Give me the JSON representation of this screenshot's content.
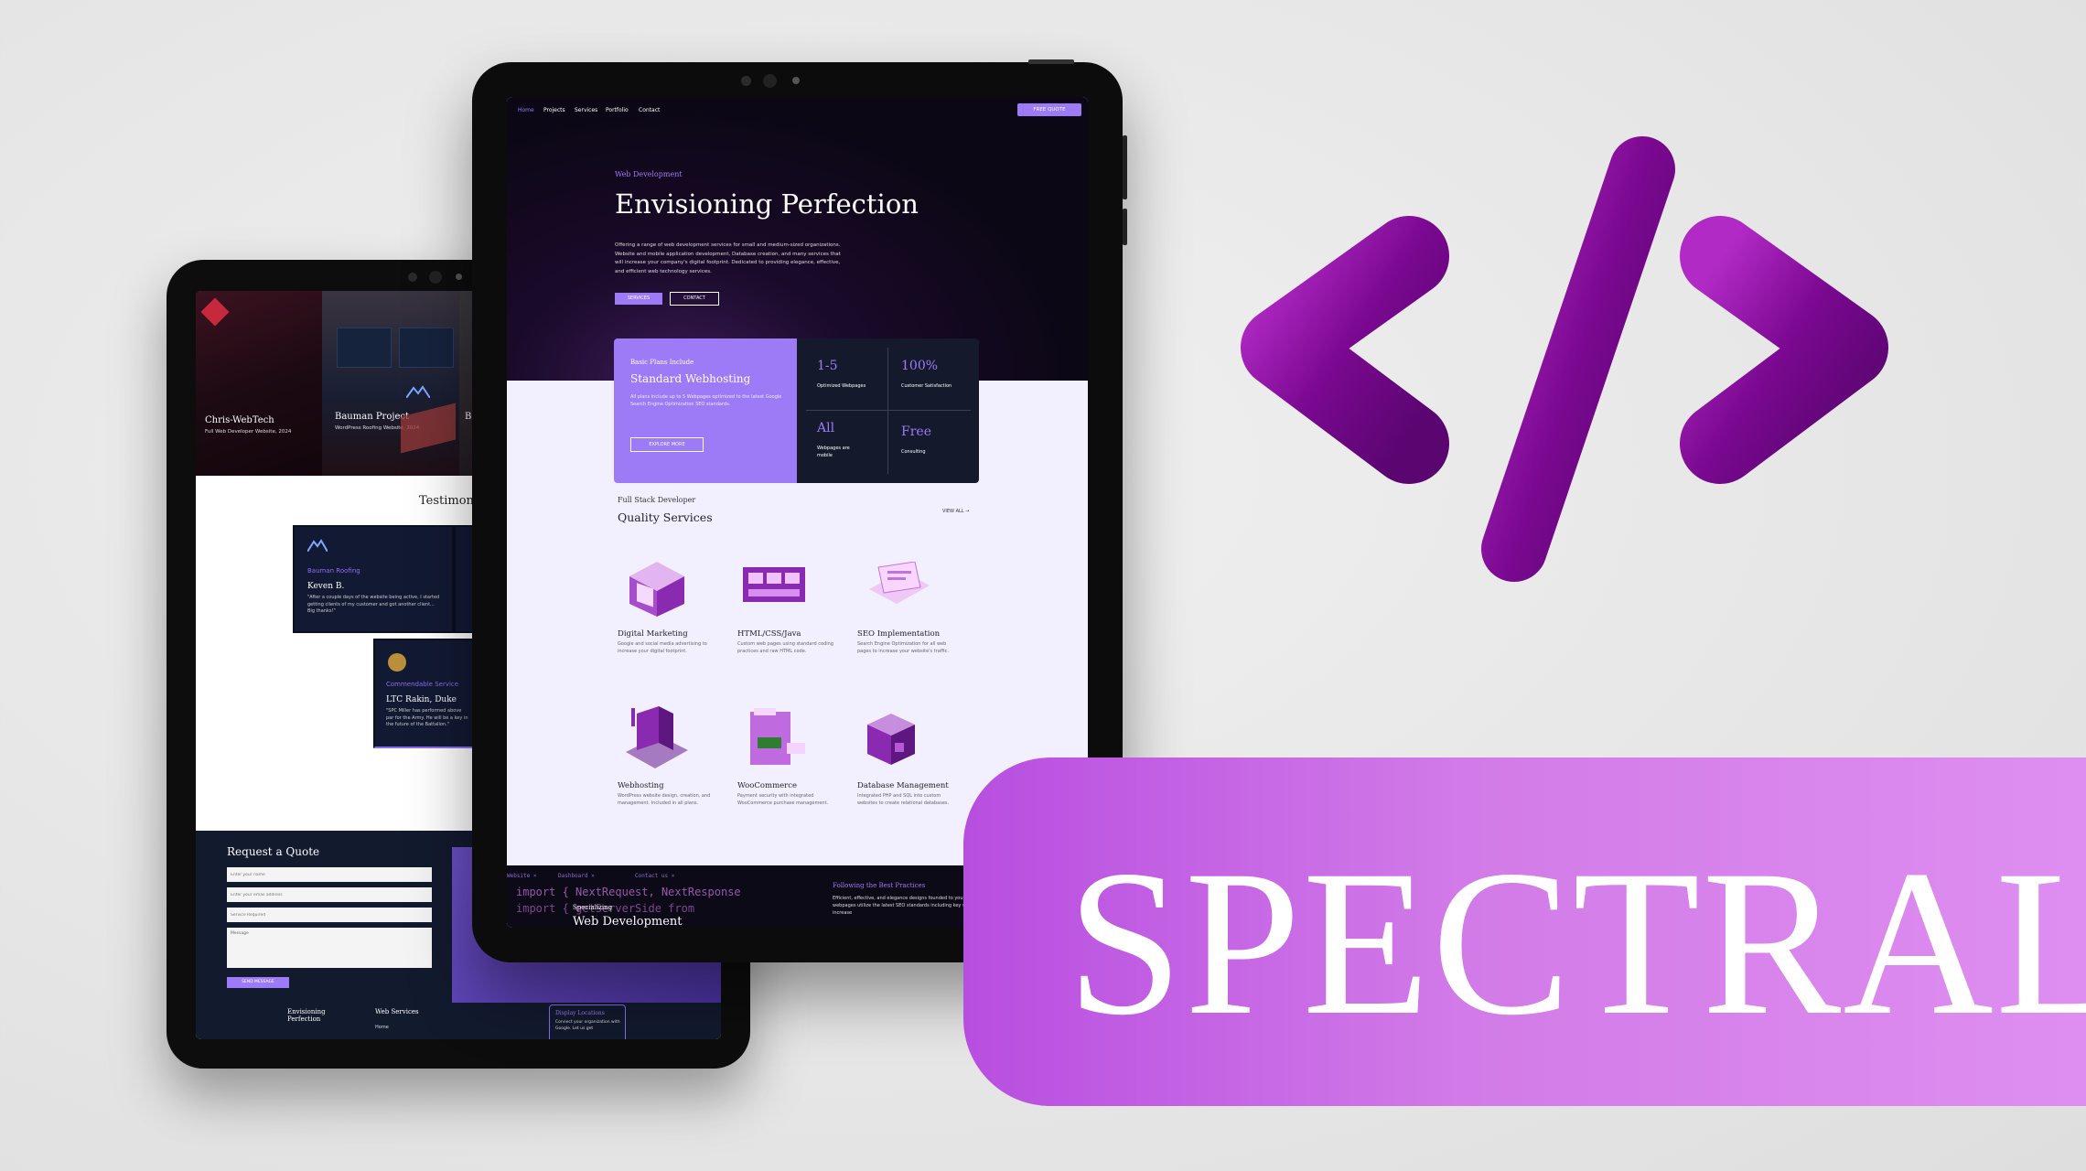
{
  "brand": {
    "name": "SPECTRAL"
  },
  "colors": {
    "accent": "#9d7bf7",
    "banner": "#d27be8",
    "code_icon": "#8a0b9e",
    "dark": "#0b0714"
  },
  "icon": {
    "name": "code-brackets-icon"
  },
  "front": {
    "nav": [
      "Home",
      "Projects",
      "Services",
      "Portfolio",
      "Contact"
    ],
    "nav_button": "FREE QUOTE",
    "hero": {
      "eyebrow": "Web Development",
      "title": "Envisioning Perfection",
      "desc": "Offering a range of web development services for small and medium-sized organizations. Website and mobile application development, Database creation, and many services that will increase your company's digital footprint. Dedicated to providing elegance, effective, and efficient web technology services.",
      "btn_services": "SERVICES",
      "btn_contact": "CONTACT"
    },
    "plan": {
      "eyebrow": "Basic Plans Include",
      "title": "Standard Webhosting",
      "desc": "All plans include up to 5 Webpages optimized to the latest Google Search Engine Optimization SEO standards.",
      "button": "EXPLORE MORE"
    },
    "stats": [
      {
        "num": "1-5",
        "label": "Optimized Webpages"
      },
      {
        "num": "100%",
        "label": "Customer Satisfaction"
      },
      {
        "num": "All",
        "label": "Webpages are mobile"
      },
      {
        "num": "Free",
        "label": "Consulting"
      }
    ],
    "services": {
      "eyebrow": "Full Stack Developer",
      "title": "Quality Services",
      "view_all": "VIEW ALL →",
      "items": [
        {
          "title": "Digital Marketing",
          "desc": "Google and social media advertising to increase your digital footprint."
        },
        {
          "title": "HTML/CSS/Java",
          "desc": "Custom web pages using standard coding practices and raw HTML code."
        },
        {
          "title": "SEO Implementation",
          "desc": "Search Engine Optimization for all web pages to increase your website's traffic."
        },
        {
          "title": "Webhosting",
          "desc": "WordPress website design, creation, and management. Included in all plans."
        },
        {
          "title": "WooCommerce",
          "desc": "Payment security with integrated WooCommerce purchase management."
        },
        {
          "title": "Database Management",
          "desc": "Integrated PHP and SQL into custom websites to create relational databases."
        }
      ]
    },
    "bottom": {
      "code_tabs": [
        "Website ×",
        "Dashboard ×",
        "Contact us ×"
      ],
      "code_lines": [
        "import { NextRequest, NextResponse",
        "import { getServerSide from"
      ],
      "code_sub": "Specializing",
      "code_title": "Web Development",
      "right_title": "Following the Best Practices",
      "right_desc": "Efficient, effective, and elegance designs founded to your organizations requirements. All webpages utilize the latest SEO standards including key word search optimization to increase"
    }
  },
  "back": {
    "projects": [
      {
        "title": "Chris-WebTech",
        "sub": "Full Web Developer Website, 2024"
      },
      {
        "title": "Bauman Project",
        "sub": "WordPress Roofing Website, 2024"
      }
    ],
    "projects_partial": "B",
    "testimonials_title": "Testimon",
    "testimonials": [
      {
        "company": "Bauman Roofing",
        "name": "Keven B.",
        "text": "\"After a couple days of the website being active, I started getting clients of my customer and got another client... Big thanks!\""
      },
      {
        "company": "Commendable Service",
        "name": "LTC Rakin, Duke",
        "text": "\"SPC Miller has performed above par for the Army. He will be a key in the future of the Battalion.\""
      }
    ],
    "quote": {
      "title": "Request a Quote",
      "name_ph": "Enter your name",
      "email_ph": "Enter your email address",
      "service_ph": "Service Required",
      "message_ph": "Message",
      "button": "SEND MESSAGE"
    },
    "footer": {
      "col1": "Envisioning Perfection",
      "col2": "Web Services",
      "col2_item": "Home",
      "badge_title": "Display Locations",
      "badge_text": "Connect your organization with Google. Let us get"
    }
  }
}
